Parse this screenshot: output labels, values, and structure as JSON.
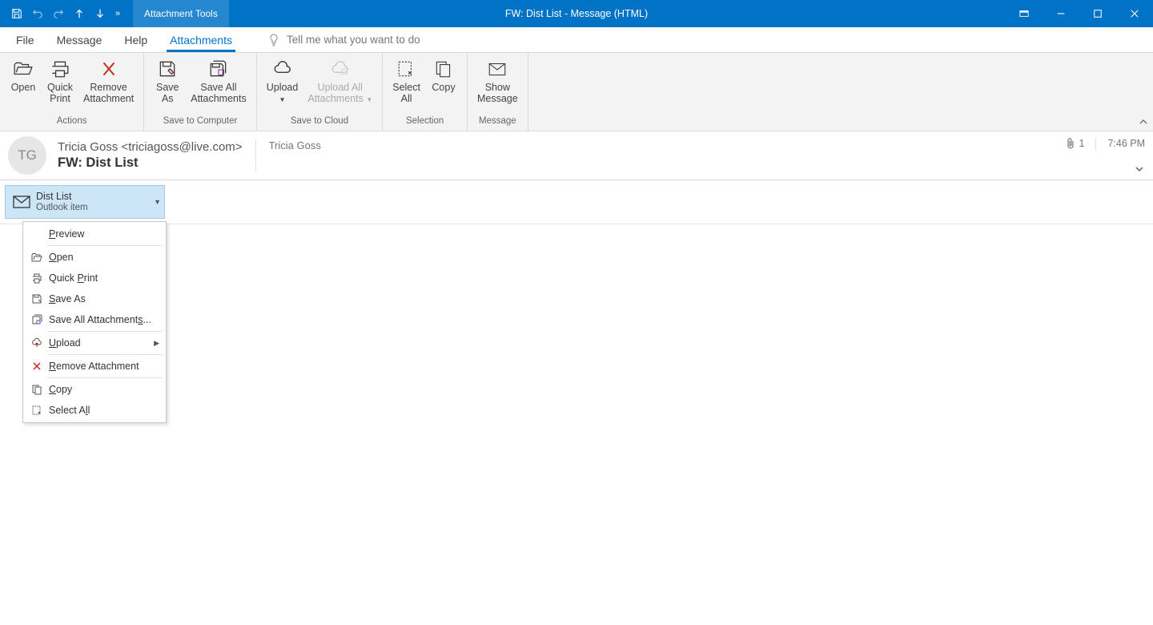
{
  "titlebar": {
    "tools_tab": "Attachment Tools",
    "window_title": "FW: Dist List  -  Message (HTML)"
  },
  "tabs": {
    "file": "File",
    "message": "Message",
    "help": "Help",
    "attachments": "Attachments",
    "tellme": "Tell me what you want to do"
  },
  "ribbon": {
    "actions": {
      "open": "Open",
      "quick_print": "Quick\nPrint",
      "remove": "Remove\nAttachment",
      "label": "Actions"
    },
    "save_computer": {
      "save_as": "Save\nAs",
      "save_all": "Save All\nAttachments",
      "label": "Save to Computer"
    },
    "save_cloud": {
      "upload": "Upload",
      "upload_all": "Upload All\nAttachments",
      "label": "Save to Cloud"
    },
    "selection": {
      "select_all": "Select\nAll",
      "copy": "Copy",
      "label": "Selection"
    },
    "message": {
      "show_message": "Show\nMessage",
      "label": "Message"
    }
  },
  "message_header": {
    "avatar_initials": "TG",
    "from": "Tricia Goss <triciagoss@live.com>",
    "subject": "FW: Dist List",
    "to": "Tricia Goss",
    "attachment_count": "1",
    "time": "7:46 PM"
  },
  "attachment": {
    "name": "Dist List",
    "type": "Outlook item"
  },
  "context_menu": {
    "preview": "Preview",
    "open": "Open",
    "quick_print": "Quick Print",
    "save_as": "Save As",
    "save_all": "Save All Attachments...",
    "upload": "Upload",
    "remove": "Remove Attachment",
    "copy": "Copy",
    "select_all": "Select All"
  }
}
